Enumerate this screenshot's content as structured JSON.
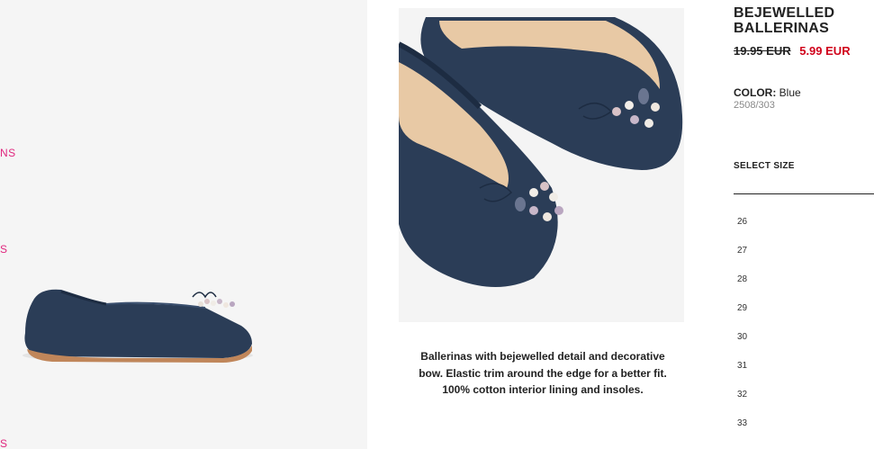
{
  "left_nav": {
    "fragment_1": "NS",
    "fragment_2": "S",
    "fragment_3": "S"
  },
  "product": {
    "title": "BEJEWELLED BALLERINAS",
    "price_old": "19.95 EUR",
    "price_new": "5.99 EUR",
    "color_label": "COLOR:",
    "color_value": "Blue",
    "reference": "2508/303",
    "description": "Ballerinas with bejewelled detail and decorative bow. Elastic trim around the edge for a better fit. 100% cotton interior lining and insoles."
  },
  "size_selector": {
    "label": "SELECT SIZE",
    "sizes": [
      "26",
      "27",
      "28",
      "29",
      "30",
      "31",
      "32",
      "33"
    ]
  },
  "colors": {
    "accent_pink": "#e0267d",
    "sale_red": "#d0021b",
    "shoe_navy": "#2b3d57"
  },
  "icons": {
    "side_photo": "navy-ballerina-side-view",
    "top_photo": "navy-ballerinas-top-view"
  }
}
